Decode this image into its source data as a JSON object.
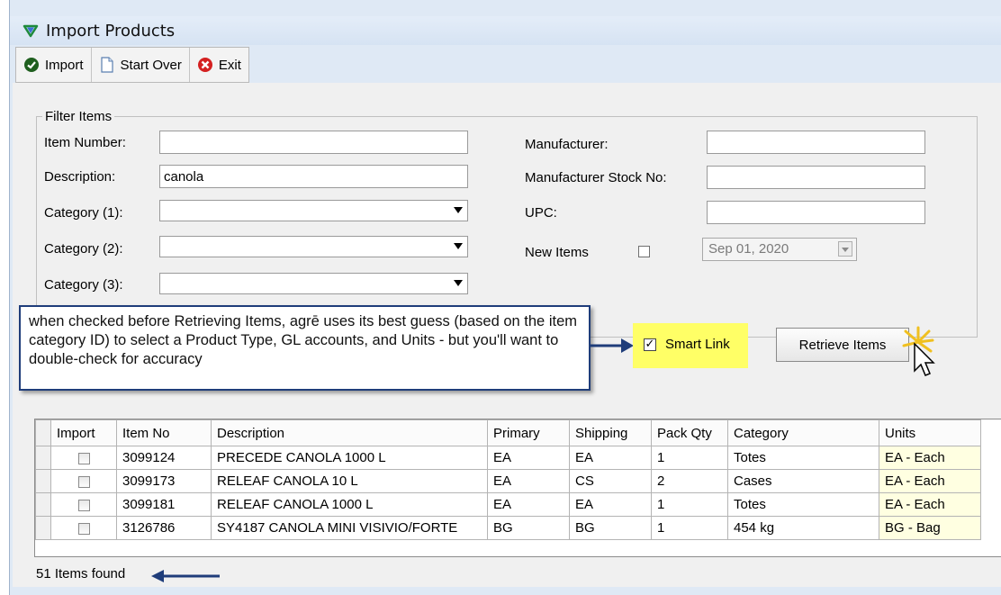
{
  "window": {
    "title": "Import Products"
  },
  "toolbar": {
    "import_label": "Import",
    "start_over_label": "Start Over",
    "exit_label": "Exit"
  },
  "filter": {
    "legend": "Filter Items",
    "item_number": {
      "label": "Item Number:",
      "value": ""
    },
    "description": {
      "label": "Description:",
      "value": "canola"
    },
    "category1": {
      "label": "Category (1):",
      "value": ""
    },
    "category2": {
      "label": "Category (2):",
      "value": ""
    },
    "category3": {
      "label": "Category (3):",
      "value": ""
    },
    "manufacturer": {
      "label": "Manufacturer:",
      "value": ""
    },
    "manufacturer_stock_no": {
      "label": "Manufacturer Stock No:",
      "value": ""
    },
    "upc": {
      "label": "UPC:",
      "value": ""
    },
    "new_items": {
      "label": "New Items",
      "checked": false,
      "date": "Sep 01, 2020"
    },
    "smart_link": {
      "label": "Smart Link",
      "checked": true
    },
    "retrieve_label": "Retrieve Items"
  },
  "callout": {
    "text": "when checked before Retrieving Items, agrē uses its best guess (based on the item category ID) to select a Product Type, GL accounts, and Units - but you'll want to double-check for accuracy"
  },
  "grid": {
    "columns": [
      "Import",
      "Item No",
      "Description",
      "Primary",
      "Shipping",
      "Pack Qty",
      "Category",
      "Units"
    ],
    "rows": [
      {
        "item_no": "3099124",
        "description": "PRECEDE CANOLA 1000 L",
        "primary": "EA",
        "shipping": "EA",
        "pack_qty": "1",
        "category": "Totes",
        "units": "EA - Each"
      },
      {
        "item_no": "3099173",
        "description": "RELEAF CANOLA 10 L",
        "primary": "EA",
        "shipping": "CS",
        "pack_qty": "2",
        "category": "Cases",
        "units": "EA - Each"
      },
      {
        "item_no": "3099181",
        "description": "RELEAF CANOLA 1000 L",
        "primary": "EA",
        "shipping": "EA",
        "pack_qty": "1",
        "category": "Totes",
        "units": "EA - Each"
      },
      {
        "item_no": "3126786",
        "description": "SY4187 CANOLA MINI VISIVIO/FORTE",
        "primary": "BG",
        "shipping": "BG",
        "pack_qty": "1",
        "category": "454 kg",
        "units": "BG - Bag"
      }
    ]
  },
  "status": {
    "text": "51 Items found"
  },
  "colors": {
    "highlight": "#ffff66",
    "arrow": "#1f3d7a",
    "units_cell": "#ffffe1"
  }
}
